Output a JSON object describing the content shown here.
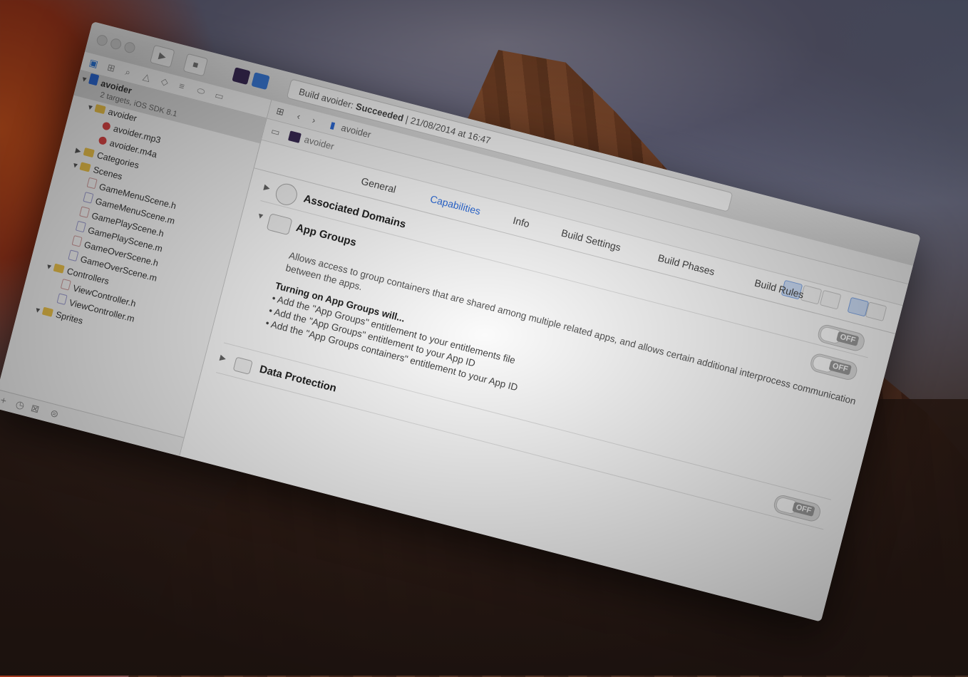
{
  "toolbar": {
    "status_prefix": "Build avoider:",
    "status_result": "Succeeded",
    "status_separator": "|",
    "status_time": "21/08/2014 at 16:47"
  },
  "navigator": {
    "project_name": "avoider",
    "project_subtitle": "2 targets, iOS SDK 8.1",
    "items": [
      {
        "label": "avoider",
        "kind": "folder",
        "depth": 1,
        "open": true
      },
      {
        "label": "avoider.mp3",
        "kind": "audio",
        "depth": 2
      },
      {
        "label": "avoider.m4a",
        "kind": "audio",
        "depth": 2
      },
      {
        "label": "Categories",
        "kind": "folder",
        "depth": 1,
        "open": false
      },
      {
        "label": "Scenes",
        "kind": "folder",
        "depth": 1,
        "open": true
      },
      {
        "label": "GameMenuScene.h",
        "kind": "h",
        "depth": 2
      },
      {
        "label": "GameMenuScene.m",
        "kind": "m",
        "depth": 2
      },
      {
        "label": "GamePlayScene.h",
        "kind": "h",
        "depth": 2
      },
      {
        "label": "GamePlayScene.m",
        "kind": "m",
        "depth": 2
      },
      {
        "label": "GameOverScene.h",
        "kind": "h",
        "depth": 2
      },
      {
        "label": "GameOverScene.m",
        "kind": "m",
        "depth": 2
      },
      {
        "label": "Controllers",
        "kind": "folder",
        "depth": 1,
        "open": true
      },
      {
        "label": "ViewController.h",
        "kind": "h",
        "depth": 2
      },
      {
        "label": "ViewController.m",
        "kind": "m",
        "depth": 2
      },
      {
        "label": "Sprites",
        "kind": "folder",
        "depth": 1,
        "open": true
      }
    ]
  },
  "editor": {
    "breadcrumb": "avoider",
    "target": "avoider",
    "tabs": [
      {
        "label": "General",
        "active": false
      },
      {
        "label": "Capabilities",
        "active": true
      },
      {
        "label": "Info",
        "active": false
      },
      {
        "label": "Build Settings",
        "active": false
      },
      {
        "label": "Build Phases",
        "active": false
      },
      {
        "label": "Build Rules",
        "active": false
      }
    ],
    "capabilities": {
      "associated_domains": {
        "title": "Associated Domains",
        "toggle": "OFF"
      },
      "app_groups": {
        "title": "App Groups",
        "toggle": "OFF",
        "description": "Allows access to group containers that are shared among multiple related apps, and allows certain additional interprocess communication between the apps.",
        "will_title": "Turning on App Groups will...",
        "steps": [
          "• Add the \"App Groups\" entitlement to your entitlements file",
          "• Add the \"App Groups\" entitlement to your App ID",
          "• Add the \"App Groups containers\" entitlement to your App ID"
        ]
      },
      "data_protection": {
        "title": "Data Protection",
        "toggle": "OFF"
      }
    }
  },
  "colors": {
    "accent": "#2f6fe0",
    "folder": "#e9c04a",
    "project": "#2d6ad6"
  }
}
